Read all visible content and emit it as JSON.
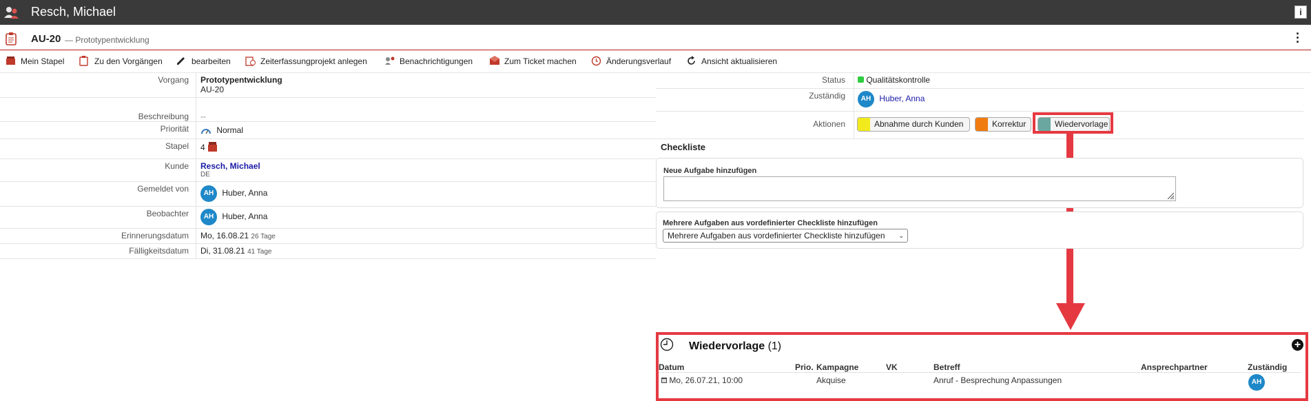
{
  "header": {
    "title": "Resch, Michael",
    "user_icon": "users-icon",
    "info_icon": "info-icon"
  },
  "case": {
    "id": "AU-20",
    "subtitle": "— Prototypentwicklung",
    "menu_icon": "more-vertical-icon"
  },
  "toolbar": {
    "items": [
      {
        "label": "Mein Stapel",
        "icon": "stack-icon"
      },
      {
        "label": "Zu den Vorgängen",
        "icon": "clipboard-icon"
      },
      {
        "label": "bearbeiten",
        "icon": "pencil-icon"
      },
      {
        "label": "Zeiterfassungprojekt anlegen",
        "icon": "time-project-icon"
      },
      {
        "label": "Benachrichtigungen",
        "icon": "notification-icon"
      },
      {
        "label": "Zum Ticket machen",
        "icon": "ticket-icon"
      },
      {
        "label": "Änderungsverlauf",
        "icon": "history-icon"
      },
      {
        "label": "Ansicht aktualisieren",
        "icon": "refresh-icon"
      }
    ]
  },
  "details": {
    "vorgang_label": "Vorgang",
    "vorgang_name": "Prototypentwicklung",
    "vorgang_id": "AU-20",
    "beschreibung_label": "Beschreibung",
    "beschreibung_value": "--",
    "prioritaet_label": "Priorität",
    "prioritaet_value": "Normal",
    "stapel_label": "Stapel",
    "stapel_value": "4",
    "kunde_label": "Kunde",
    "kunde_name": "Resch, Michael",
    "kunde_land": "DE",
    "gemeldet_label": "Gemeldet von",
    "gemeldet_initials": "AH",
    "gemeldet_name": "Huber, Anna",
    "beobachter_label": "Beobachter",
    "beobachter_initials": "AH",
    "beobachter_name": "Huber, Anna",
    "erinnerung_label": "Erinnerungsdatum",
    "erinnerung_date": "Mo, 16.08.21",
    "erinnerung_days": "26 Tage",
    "faellig_label": "Fälligkeitsdatum",
    "faellig_date": "Di, 31.08.21",
    "faellig_days": "41 Tage"
  },
  "status": {
    "status_label": "Status",
    "status_value": "Qualitätskontrolle",
    "status_color": "#2ecc40",
    "zustaendig_label": "Zuständig",
    "zustaendig_initials": "AH",
    "zustaendig_name": "Huber, Anna",
    "aktionen_label": "Aktionen",
    "actions": [
      {
        "label": "Abnahme durch Kunden",
        "color": "#f2ea1c"
      },
      {
        "label": "Korrektur",
        "color": "#f07c0f"
      },
      {
        "label": "Wiedervorlage",
        "color": "#6aa7a0"
      }
    ]
  },
  "checklist": {
    "title": "Checkliste",
    "new_task_label": "Neue Aufgabe hinzufügen",
    "multi_label": "Mehrere Aufgaben aus vordefinierter Checkliste hinzufügen",
    "multi_select": "Mehrere Aufgaben aus vordefinierter Checkliste hinzufügen"
  },
  "wiedervorlage": {
    "title": "Wiedervorlage",
    "count": "(1)",
    "columns": [
      "Datum",
      "Prio.",
      "Kampagne",
      "VK",
      "Betreff",
      "Ansprechpartner",
      "Zuständig"
    ],
    "rows": [
      {
        "datum": "Mo, 26.07.21, 10:00",
        "prio": "",
        "kampagne": "Akquise",
        "vk": "",
        "betreff": "Anruf - Besprechung Anpassungen",
        "ansprechpartner": "",
        "zustaendig": "AH"
      }
    ]
  },
  "colors": {
    "accent_red": "#e53942",
    "topbar": "#3a3a3a",
    "avatar_blue": "#1e88c8",
    "link_blue": "#1a1aa6"
  }
}
